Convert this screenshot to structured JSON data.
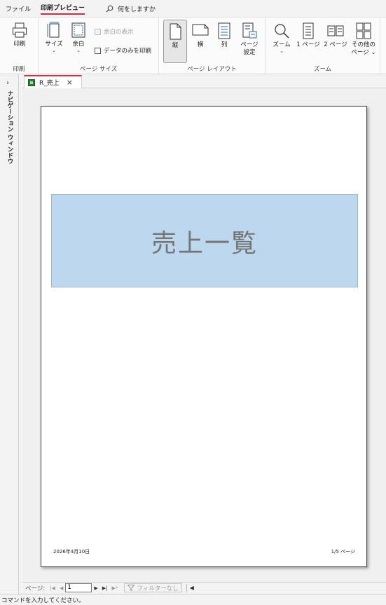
{
  "menu": {
    "file": "ファイル",
    "print_preview": "印刷プレビュー",
    "tell_me": "何をしますか"
  },
  "ribbon": {
    "print_group": {
      "label": "印刷",
      "print_button": "印刷"
    },
    "page_size_group": {
      "label": "ページ サイズ",
      "size_button": "サイズ",
      "margins_button": "余白",
      "show_margins": "余白の表示",
      "print_data_only": "データのみを印刷"
    },
    "page_layout_group": {
      "label": "ページ レイアウト",
      "portrait": "縦",
      "landscape": "横",
      "columns": "列",
      "page_setup_line1": "ページ",
      "page_setup_line2": "設定"
    },
    "zoom_group": {
      "label": "ズーム",
      "zoom_button": "ズーム",
      "one_page": "1 ページ",
      "two_pages": "2 ページ",
      "more_pages_line1": "その他の",
      "more_pages_line2": "ページ"
    }
  },
  "nav_pane": {
    "title": "ナビゲーション ウィンドウ"
  },
  "document_tab": {
    "name": "R_売上"
  },
  "report": {
    "title": "売上一覧",
    "footer_date": "2026年4月10日",
    "footer_page": "1/5 ページ",
    "title_band_color": "#bdd7ee"
  },
  "record_nav": {
    "label": "ページ:",
    "current_page": "1",
    "filter": "フィルターなし"
  },
  "status": {
    "text": "コマンドを入力してください。"
  },
  "colors": {
    "accent": "#c4314b"
  }
}
